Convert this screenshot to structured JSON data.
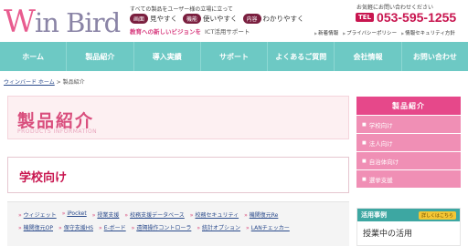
{
  "header": {
    "logo_text": "Win Bird",
    "tagline": "すべての製品をユーザー様の立場に立って",
    "pills": [
      {
        "badge": "画面",
        "text": "見やすく"
      },
      {
        "badge": "機能",
        "text": "使いやすく"
      },
      {
        "badge": "内容",
        "text": "わかりやすく"
      }
    ],
    "slogan": "教育への新しいビジョンを",
    "slogan_sub": "ICT活用サポート",
    "contact_label": "お気軽にお問い合わせください",
    "tel_badge": "TEL",
    "tel_number": "053-595-1255",
    "links": [
      "新着情報",
      "プライバシーポリシー",
      "情報セキュリティ方針"
    ]
  },
  "nav": [
    "ホーム",
    "製品紹介",
    "導入実績",
    "サポート",
    "よくあるご質問",
    "会社情報",
    "お問い合わせ"
  ],
  "breadcrumb": {
    "home": "ウィンバード ホーム",
    "sep": " > ",
    "current": "製品紹介"
  },
  "page": {
    "title": "製品紹介",
    "title_en": "PRODUCTS INFORMATION",
    "category": "学校向け"
  },
  "product_links": {
    "row1": [
      "ウィジェット",
      "iPocket",
      "授業支援",
      "校務支援データベース",
      "校務セキュリティ",
      "機関復元Re"
    ],
    "row2": [
      "機関復元OP",
      "保守支援HS",
      "E-ボード",
      "遠隔操作コントローラ",
      "統計オプション",
      "LANチェッカー"
    ]
  },
  "sidebar": {
    "heading": "製品紹介",
    "items": [
      "学校向け",
      "法人向け",
      "自治体向け",
      "選挙支援"
    ]
  },
  "case": {
    "label": "活用事例",
    "button": "詳しくはこちら",
    "body": "授業中の活用"
  }
}
